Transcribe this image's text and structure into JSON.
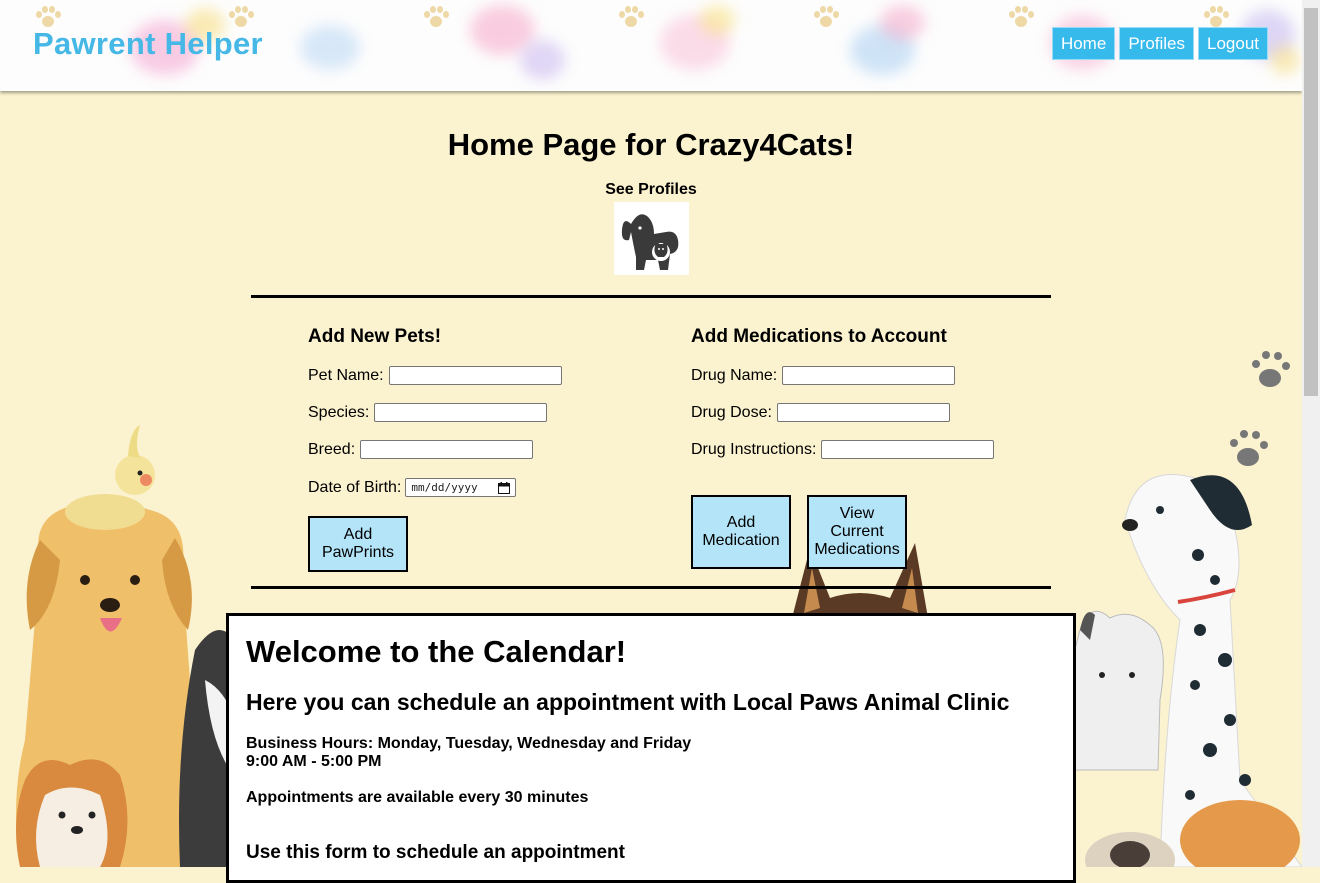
{
  "header": {
    "brand": "Pawrent Helper",
    "nav": [
      {
        "label": "Home"
      },
      {
        "label": "Profiles"
      },
      {
        "label": "Logout"
      }
    ]
  },
  "main": {
    "title": "Home Page for Crazy4Cats!",
    "see_profiles_label": "See Profiles",
    "profiles_icon": "dog-and-cat-icon",
    "pets_form": {
      "title": "Add New Pets!",
      "fields": [
        {
          "label": "Pet Name:",
          "value": ""
        },
        {
          "label": "Species:",
          "value": ""
        },
        {
          "label": "Breed:",
          "value": ""
        },
        {
          "label": "Date of Birth:",
          "placeholder": "mm/dd/yyyy"
        }
      ],
      "submit_label": "Add PawPrints"
    },
    "meds_form": {
      "title": "Add Medications to Account",
      "fields": [
        {
          "label": "Drug Name:",
          "value": ""
        },
        {
          "label": "Drug Dose:",
          "value": ""
        },
        {
          "label": "Drug Instructions:",
          "value": ""
        }
      ],
      "add_label": "Add Medication",
      "view_label": "View Current Medications"
    }
  },
  "calendar": {
    "heading": "Welcome to the Calendar!",
    "subheading": "Here you can schedule an appointment with Local Paws Animal Clinic",
    "hours_line1": "Business Hours: Monday, Tuesday, Wednesday and Friday",
    "hours_line2": "9:00 AM - 5:00 PM",
    "availability": "Appointments are available every 30 minutes",
    "form_heading": "Use this form to schedule an appointment"
  },
  "colors": {
    "brand": "#45b8e6",
    "nav_button": "#36b9eb",
    "action_button": "#b3e4f8",
    "page_background": "#fbf2cf"
  }
}
